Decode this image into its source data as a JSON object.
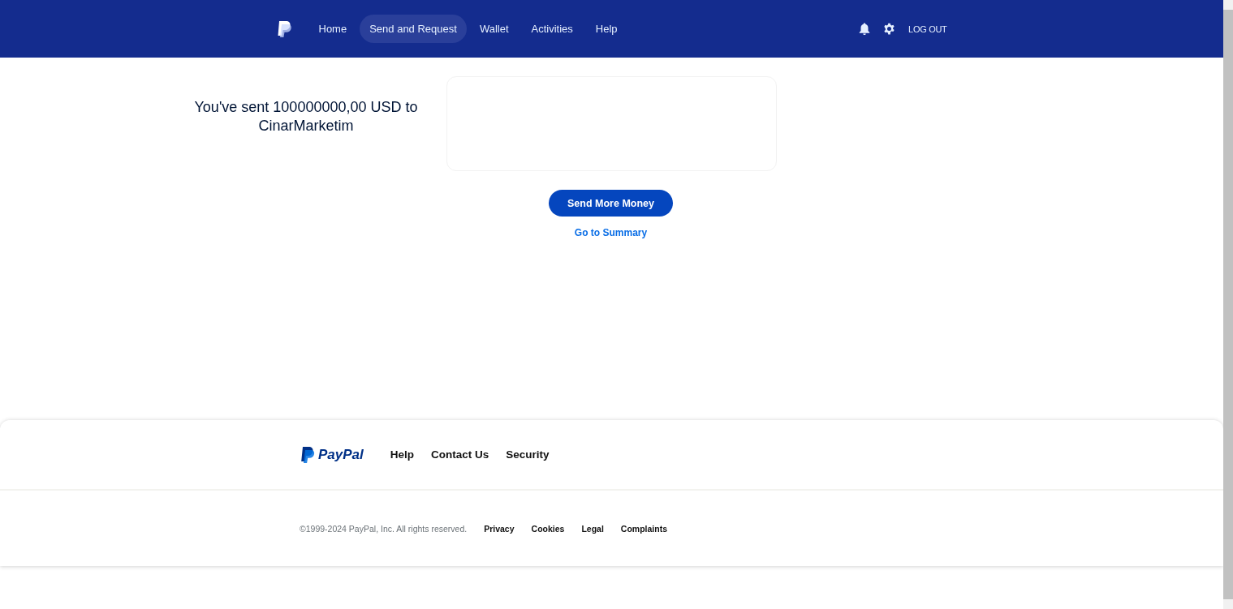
{
  "header": {
    "nav": [
      {
        "label": "Home",
        "selected": false
      },
      {
        "label": "Send and Request",
        "selected": true
      },
      {
        "label": "Wallet",
        "selected": false
      },
      {
        "label": "Activities",
        "selected": false
      },
      {
        "label": "Help",
        "selected": false
      }
    ],
    "logout": "LOG OUT"
  },
  "confirmation": {
    "message": "You've sent 100000000,00 USD to CinarMarketim",
    "primary_button": "Send More Money",
    "link": "Go to Summary"
  },
  "footer": {
    "logo_text": "PayPal",
    "links": [
      "Help",
      "Contact Us",
      "Security"
    ],
    "copyright": "©1999-2024 PayPal, Inc. All rights reserved.",
    "legal_links": [
      "Privacy",
      "Cookies",
      "Legal",
      "Complaints"
    ]
  }
}
